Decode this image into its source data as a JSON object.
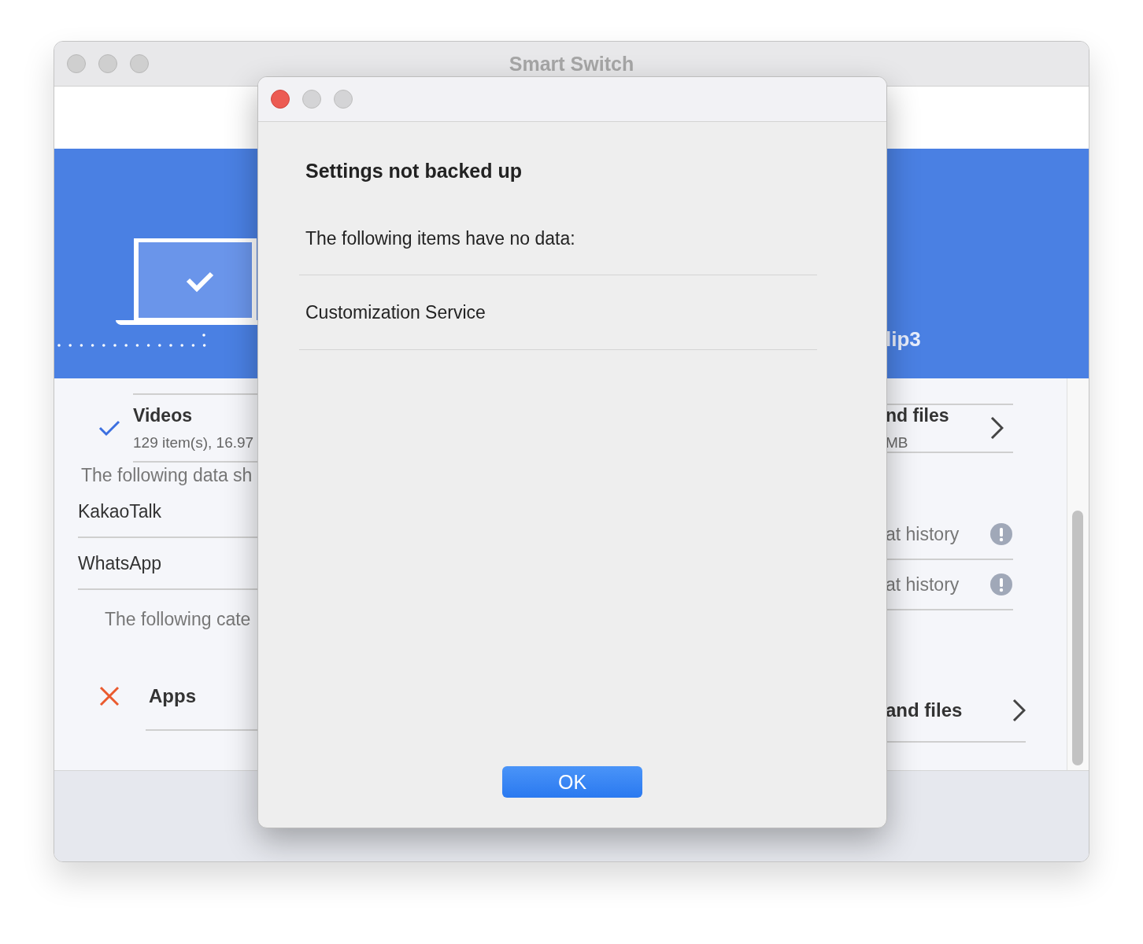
{
  "window": {
    "title": "Smart Switch"
  },
  "header": {
    "device_name": "lip3"
  },
  "left": {
    "category": {
      "name": "Videos",
      "detail": "129 item(s), 16.97",
      "kind": "done"
    },
    "note": "The following data sh",
    "apps": [
      {
        "name": "KakaoTalk"
      },
      {
        "name": "WhatsApp"
      }
    ],
    "note2": "The following cate",
    "failed": {
      "name": "Apps",
      "kind": "failed"
    }
  },
  "right": {
    "category": {
      "name": "nd files",
      "detail": "MB"
    },
    "apps": [
      {
        "detail": "at history",
        "warning": true
      },
      {
        "detail": "at history",
        "warning": true
      }
    ],
    "failed": {
      "name": "and files"
    }
  },
  "dialog": {
    "title": "Settings not backed up",
    "message": "The following items have no data:",
    "items": [
      "Customization Service"
    ],
    "button": "OK"
  }
}
